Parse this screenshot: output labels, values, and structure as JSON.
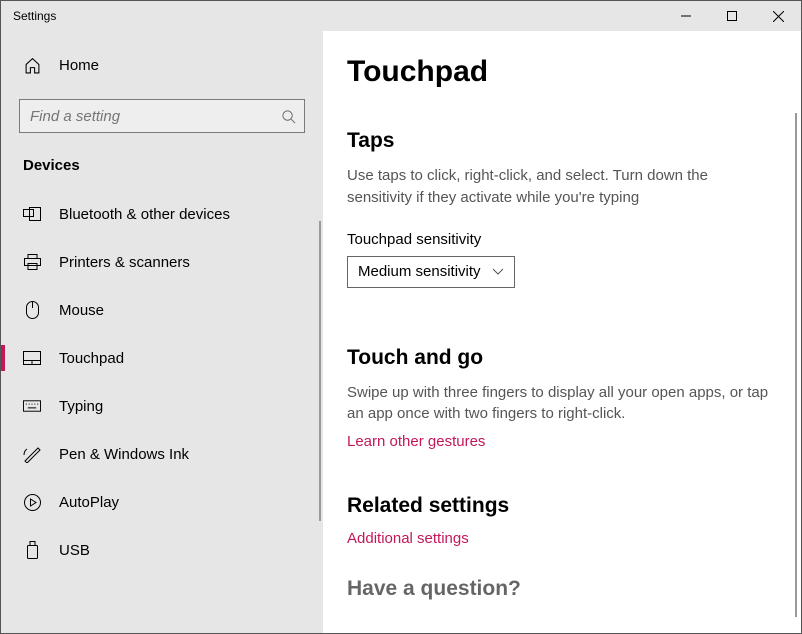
{
  "window": {
    "title": "Settings"
  },
  "sidebar": {
    "home_label": "Home",
    "search_placeholder": "Find a setting",
    "category_label": "Devices",
    "items": [
      {
        "label": "Bluetooth & other devices",
        "icon": "bluetooth-devices",
        "active": false
      },
      {
        "label": "Printers & scanners",
        "icon": "printer",
        "active": false
      },
      {
        "label": "Mouse",
        "icon": "mouse",
        "active": false
      },
      {
        "label": "Touchpad",
        "icon": "touchpad",
        "active": true
      },
      {
        "label": "Typing",
        "icon": "keyboard",
        "active": false
      },
      {
        "label": "Pen & Windows Ink",
        "icon": "pen",
        "active": false
      },
      {
        "label": "AutoPlay",
        "icon": "autoplay",
        "active": false
      },
      {
        "label": "USB",
        "icon": "usb",
        "active": false
      }
    ]
  },
  "content": {
    "page_title": "Touchpad",
    "taps": {
      "heading": "Taps",
      "description": "Use taps to click, right-click, and select. Turn down the sensitivity if they activate while you're typing",
      "sensitivity_label": "Touchpad sensitivity",
      "sensitivity_value": "Medium sensitivity"
    },
    "touch_and_go": {
      "heading": "Touch and go",
      "description": "Swipe up with three fingers to display all your open apps, or tap an app once with two fingers to right-click.",
      "link": "Learn other gestures"
    },
    "related": {
      "heading": "Related settings",
      "link": "Additional settings"
    },
    "question_heading": "Have a question?"
  }
}
